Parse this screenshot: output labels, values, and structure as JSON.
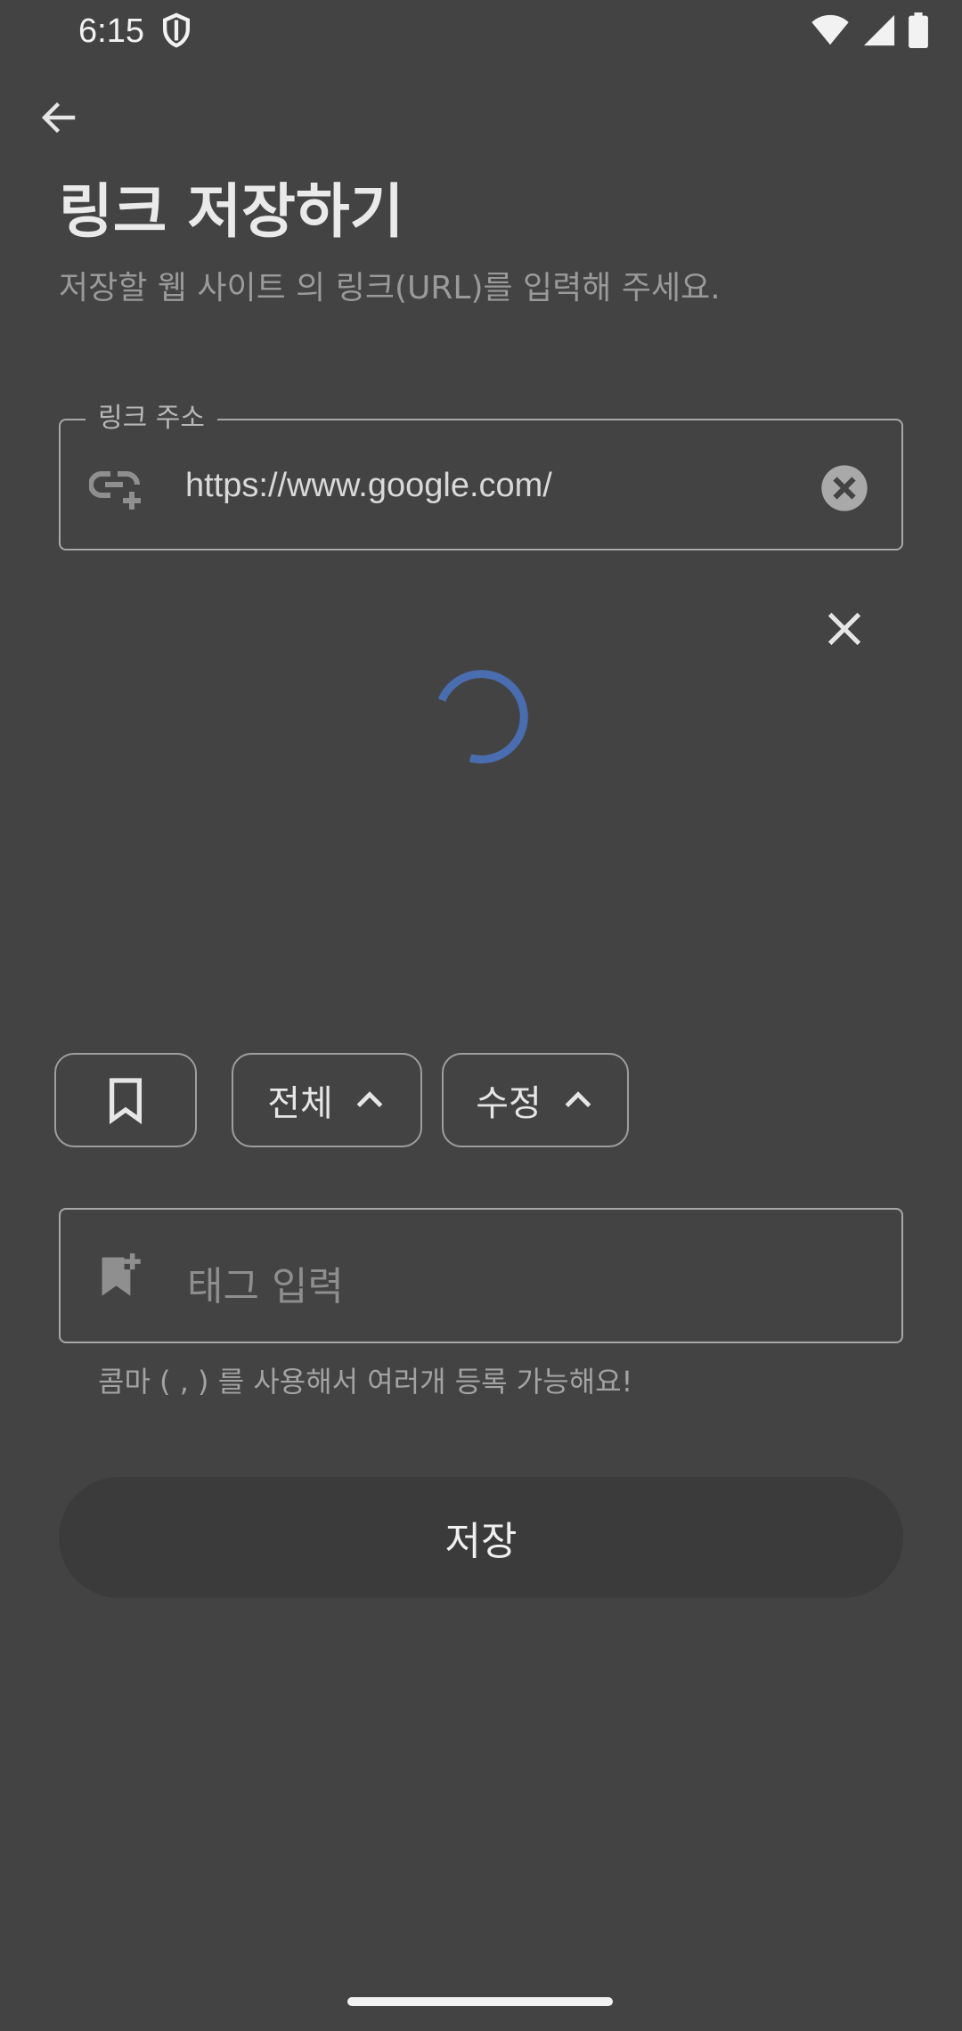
{
  "status_bar": {
    "time": "6:15",
    "icons": [
      "shield-icon",
      "wifi-icon",
      "signal-icon",
      "battery-icon"
    ]
  },
  "app_bar": {
    "back_icon": "arrow-back-icon"
  },
  "header": {
    "title": "링크 저장하기",
    "subtitle": "저장할 웹 사이트 의 링크(URL)를 입력해 주세요."
  },
  "link_field": {
    "label": "링크 주소",
    "value": "https://www.google.com/",
    "leading_icon": "add-link-icon",
    "trailing_icon": "clear-circle-icon"
  },
  "preview": {
    "dismiss_icon": "close-icon",
    "loading_icon": "loading-spinner-icon"
  },
  "options": {
    "bookmark_icon": "bookmark-outline-icon",
    "category_label": "전체",
    "edit_label": "수정",
    "expand_icon": "chevron-up-icon"
  },
  "tag_field": {
    "placeholder": "태그 입력",
    "icon": "bookmark-add-icon",
    "helper": "콤마 ( , ) 를 사용해서 여러개 등록 가능해요!"
  },
  "actions": {
    "save_label": "저장"
  },
  "colors": {
    "background": "#434344",
    "spinner": "#4a6db0",
    "save_button": "#3b3b3c"
  }
}
